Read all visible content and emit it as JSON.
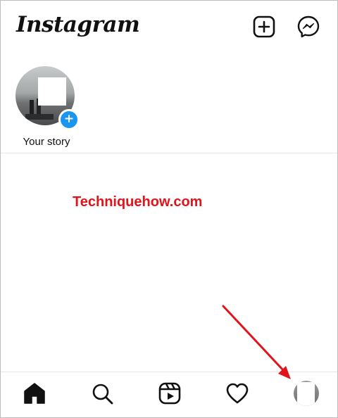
{
  "app": {
    "logo_text": "Instagram"
  },
  "header": {
    "icons": [
      "new-post-icon",
      "messenger-icon"
    ]
  },
  "stories": {
    "items": [
      {
        "label": "Your story",
        "add_badge": "+"
      }
    ]
  },
  "watermark": {
    "text": "Techniquehow.com",
    "color": "#e1141b"
  },
  "bottom_nav": {
    "items": [
      "home-icon",
      "search-icon",
      "reels-icon",
      "activity-heart-icon",
      "profile-avatar"
    ],
    "active": "home"
  },
  "colors": {
    "accent_blue": "#1a96f0",
    "annotation_red": "#e1141b"
  }
}
